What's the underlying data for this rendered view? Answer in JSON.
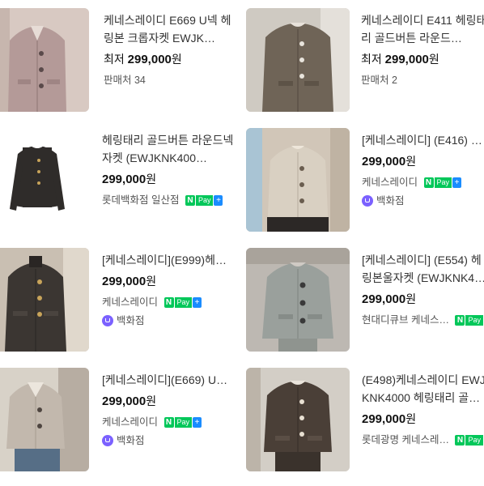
{
  "products": [
    {
      "title": "케네스레이디 E669 U넥 헤링본 크롭자켓 EWJK…",
      "price_label": "최저",
      "price": "299,000",
      "unit": "원",
      "meta": "판매처 34",
      "theme": {
        "bg": "#d8c9c2",
        "jacket": "#b49a98"
      }
    },
    {
      "title": "케네스레이디 E411 헤링태리 골드버튼 라운드…",
      "price_label": "최저",
      "price": "299,000",
      "unit": "원",
      "meta": "판매처 2",
      "theme": {
        "bg": "#cfcac2",
        "jacket": "#6f6457"
      }
    },
    {
      "title": "헤링태리 골드버튼 라운드넥 자켓 (EWJKNK400…",
      "price": "299,000",
      "unit": "원",
      "seller": "롯데백화점 일산점",
      "npay": {
        "n": "N",
        "pay": "Pay",
        "plus": "+"
      },
      "theme": {
        "bg": "#ffffff",
        "jacket": "#2f2c2a"
      }
    },
    {
      "title": "[케네스레이디] (E416) …",
      "price": "299,000",
      "unit": "원",
      "seller": "케네스레이디",
      "npay": {
        "n": "N",
        "pay": "Pay",
        "plus": "+"
      },
      "dept": "백화점",
      "theme": {
        "bg": "#d1c6b8",
        "jacket": "#d9d0c2"
      }
    },
    {
      "title": "[케네스레이디](E999)헤…",
      "price": "299,000",
      "unit": "원",
      "seller": "케네스레이디",
      "npay": {
        "n": "N",
        "pay": "Pay",
        "plus": "+"
      },
      "dept": "백화점",
      "theme": {
        "bg": "#c9bfb2",
        "jacket": "#3b3632"
      }
    },
    {
      "title": "[케네스레이디] (E554) 헤링본울자켓 (EWJKNK40…",
      "price": "299,000",
      "unit": "원",
      "seller": "현대디큐브 케네스…",
      "npay": {
        "n": "N",
        "pay": "Pay",
        "plus": "+"
      },
      "theme": {
        "bg": "#bdb8b2",
        "jacket": "#9aa09c"
      }
    },
    {
      "title": "[케네스레이디](E669) U…",
      "price": "299,000",
      "unit": "원",
      "seller": "케네스레이디",
      "npay": {
        "n": "N",
        "pay": "Pay",
        "plus": "+"
      },
      "dept": "백화점",
      "theme": {
        "bg": "#d8d2c8",
        "jacket": "#c2b8ad"
      }
    },
    {
      "title": "(E498)케네스레이디 EWJKNK4000 헤링태리 골…",
      "price": "299,000",
      "unit": "원",
      "seller": "롯데광명 케네스레…",
      "npay": {
        "n": "N",
        "pay": "Pay",
        "plus": "+"
      },
      "theme": {
        "bg": "#d3cec6",
        "jacket": "#4a3f37"
      }
    }
  ]
}
